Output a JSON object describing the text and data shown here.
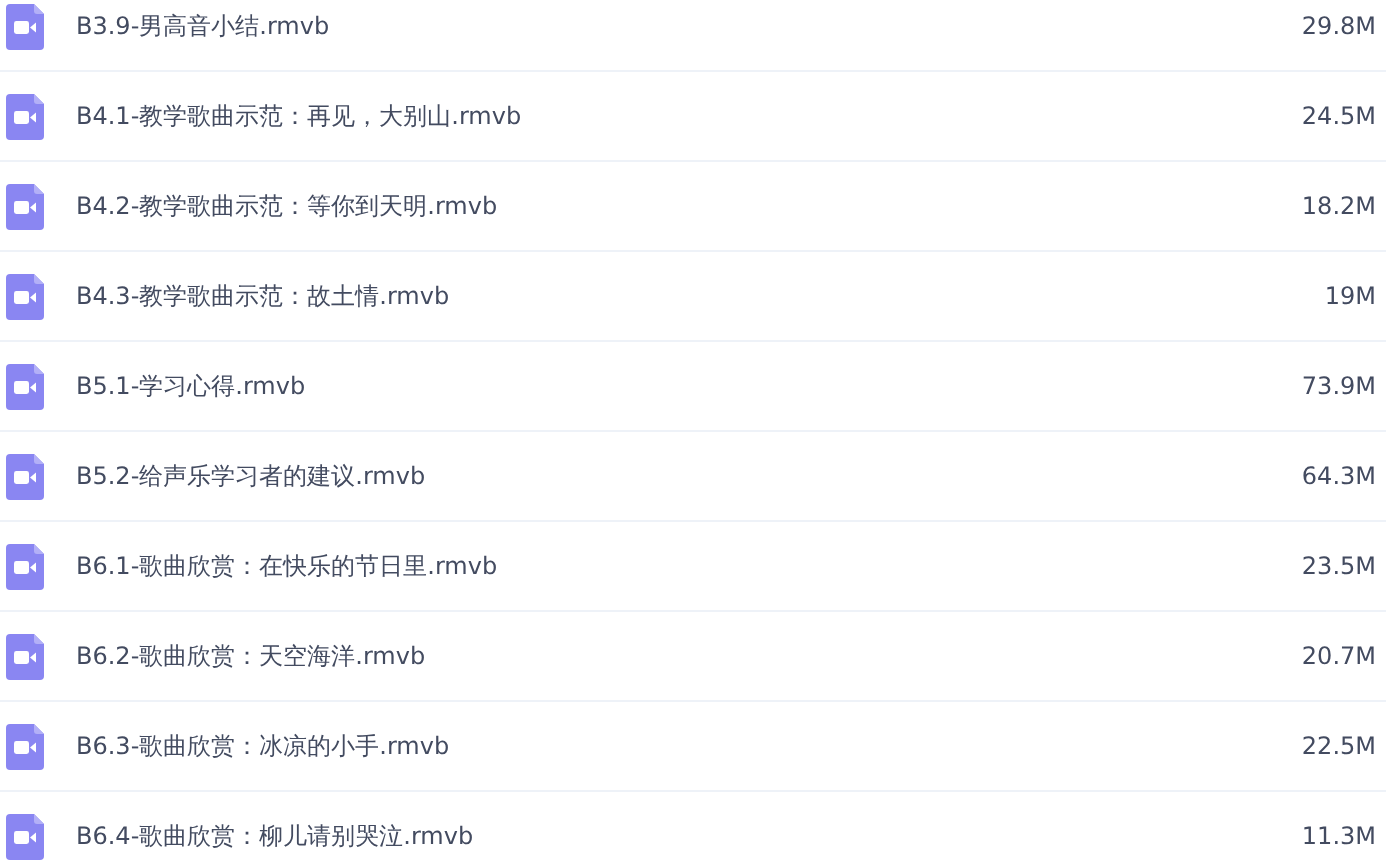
{
  "files": [
    {
      "name": "B3.9-男高音小结.rmvb",
      "size": "29.8M"
    },
    {
      "name": "B4.1-教学歌曲示范：再见，大别山.rmvb",
      "size": "24.5M"
    },
    {
      "name": "B4.2-教学歌曲示范：等你到天明.rmvb",
      "size": "18.2M"
    },
    {
      "name": "B4.3-教学歌曲示范：故土情.rmvb",
      "size": "19M"
    },
    {
      "name": "B5.1-学习心得.rmvb",
      "size": "73.9M"
    },
    {
      "name": "B5.2-给声乐学习者的建议.rmvb",
      "size": "64.3M"
    },
    {
      "name": "B6.1-歌曲欣赏：在快乐的节日里.rmvb",
      "size": "23.5M"
    },
    {
      "name": "B6.2-歌曲欣赏：天空海洋.rmvb",
      "size": "20.7M"
    },
    {
      "name": "B6.3-歌曲欣赏：冰凉的小手.rmvb",
      "size": "22.5M"
    },
    {
      "name": "B6.4-歌曲欣赏：柳儿请别哭泣.rmvb",
      "size": "11.3M"
    }
  ]
}
